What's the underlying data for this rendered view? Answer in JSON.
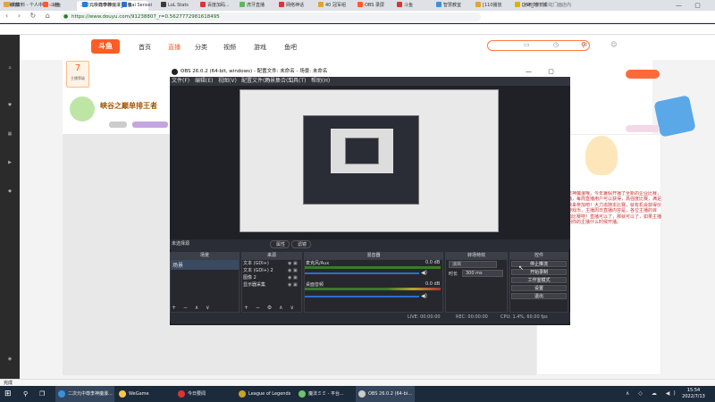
{
  "browser": {
    "tabs": [
      {
        "label": "我的资料 - 个人中心 - 斗鱼"
      },
      {
        "label": "二次元中尊李神魔瀑_斗鱼"
      }
    ],
    "url": "https://www.douyu.com/91238807_r=0.5627772981618495",
    "bookmarks": [
      "收藏",
      "斗鱼",
      "二次元中尊",
      "Bai Sensei",
      "LoL Stats",
      "百度加码...",
      "虎牙直播",
      "网络神话",
      "40 冠军组",
      "OBS 录屏",
      "斗鱼",
      "智慧教室",
      "[110播放",
      "DNF_地下城"
    ],
    "top_right": "上海欧莱达彩虹门面店内"
  },
  "site": {
    "logo": "斗鱼",
    "nav": [
      "首页",
      "直播",
      "分类",
      "视频",
      "游戏",
      "鱼吧"
    ],
    "promo_title": "峡谷之巅单排王者",
    "promo_badge": "7",
    "badge_text": "主播等级",
    "right_text": "二次元中尊李神魔瀑哦，今年暑假开播了全新的企业比赛，活动期间直播，每周直播用户可以获得，高强度比赛，满足超级经理，快来参加吧！大力追随本比赛，就有机会获得价值一百元的游戏币，主播周日直播内容是，各位主播的目标，快来参加比赛吧！直播可以了，那就可以了，如果主播在这里，请问你的主播什么时候开播。",
    "footer_text": "完成"
  },
  "obs": {
    "title": "OBS 26.0.2 (64-bit, windows) - 配置文件: 未命名 - 场景: 未命名",
    "menu": [
      "文件(F)",
      "编辑(E)",
      "视图(V)",
      "配置文件(P)",
      "场景集合(S)",
      "工具(T)",
      "帮助(H)"
    ],
    "no_source": "未选择源",
    "props_btn": "属性",
    "filters_btn": "滤镜",
    "docks": {
      "scenes": "场景",
      "sources": "来源",
      "mixer": "混音器",
      "transitions": "转场特效",
      "controls": "控件"
    },
    "scene_item": "场景",
    "sources": [
      "文本 (GDI+)",
      "文本 (GDI+) 2",
      "图像 2",
      "显示器采集"
    ],
    "mixer": [
      {
        "name": "麦克风/Aux",
        "db": "0.0 dB"
      },
      {
        "name": "桌面音频",
        "db": "0.0 dB"
      }
    ],
    "transition": {
      "type": "淡出",
      "duration_label": "时长",
      "duration": "300 ms"
    },
    "controls": [
      "停止推流",
      "开始录制",
      "工作室模式",
      "设置",
      "退出"
    ],
    "status": {
      "live": "LIVE: 00:00:00",
      "rec": "REC: 00:00:00",
      "cpu": "CPU: 1.4%, 60.00 fps"
    }
  },
  "taskbar": {
    "items": [
      {
        "label": "二次元中尊李神魔瀑..."
      },
      {
        "label": "WeGame"
      },
      {
        "label": "今日要闻"
      },
      {
        "label": "League of Legends"
      },
      {
        "label": "魔法ミミ - 平台..."
      },
      {
        "label": "OBS 26.0.2 (64-bi..."
      }
    ],
    "time": "15:54",
    "date": "2022/7/13"
  },
  "colors": {
    "accent": "#ff5d23",
    "obs_bg": "#2a2d35",
    "taskbar": "#1c2b3c"
  }
}
